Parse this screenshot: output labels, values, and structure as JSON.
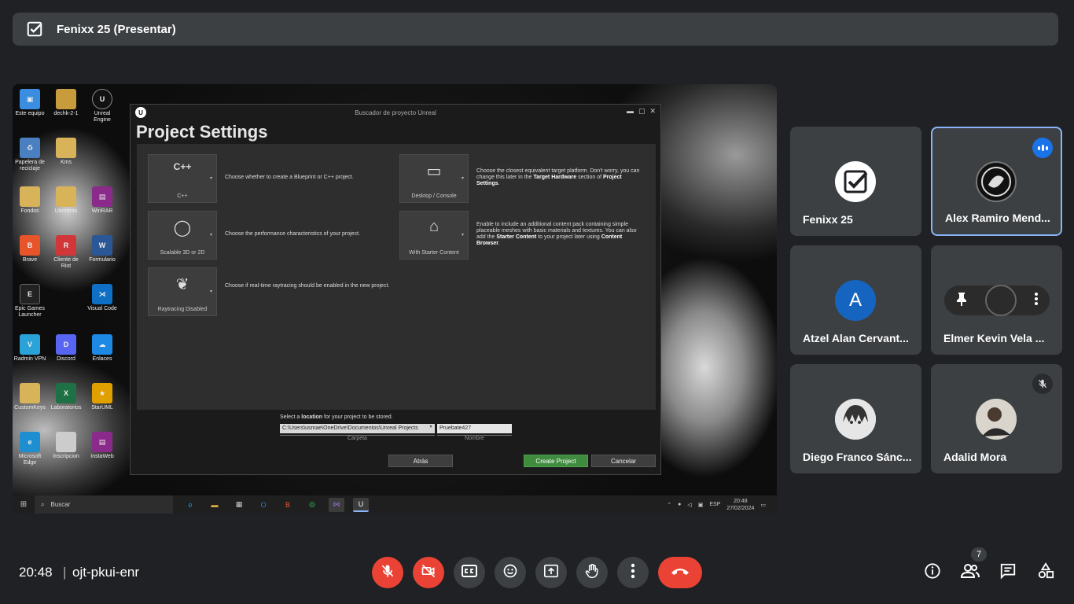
{
  "presenter": {
    "name": "Fenixx 25 (Presentar)"
  },
  "desktop": {
    "icons": [
      {
        "label": "Este equipo",
        "color": "#3a8de0"
      },
      {
        "label": "dechk-2-1",
        "color": "#c89b3c"
      },
      {
        "label": "Unreal Engine",
        "color": "#111111"
      },
      {
        "label": "Papelera de reciclaje",
        "color": "#4a7fc1"
      },
      {
        "label": "Kms",
        "color": "#d8b35a"
      },
      {
        "label": "Fondos",
        "color": "#d8b35a"
      },
      {
        "label": "Utorrents",
        "color": "#d8b35a"
      },
      {
        "label": "WinRAR",
        "color": "#8a2a8a"
      },
      {
        "label": "Brave",
        "color": "#e8542a"
      },
      {
        "label": "Cliente de Riot",
        "color": "#d13639"
      },
      {
        "label": "Formulario",
        "color": "#2b5797"
      },
      {
        "label": "Epic Games Launcher",
        "color": "#222222"
      },
      {
        "label": "Visual Code",
        "color": "#0e6fc5"
      },
      {
        "label": "Radmin VPN",
        "color": "#2aa3d8"
      },
      {
        "label": "Discord",
        "color": "#5865f2"
      },
      {
        "label": "Enlaces",
        "color": "#1e88e5"
      },
      {
        "label": "CustomKeys",
        "color": "#d8b35a"
      },
      {
        "label": "Laboratorios",
        "color": "#1e7145"
      },
      {
        "label": "StarUML",
        "color": "#e0a000"
      },
      {
        "label": "Microsoft Edge",
        "color": "#1d8fd1"
      },
      {
        "label": "Inscripcion",
        "color": "#cccccc"
      },
      {
        "label": "InstaWeb",
        "color": "#8a2a8a"
      }
    ]
  },
  "ue": {
    "window_title": "Buscador de proyecto Unreal",
    "heading": "Project Settings",
    "logo": "U",
    "options": [
      {
        "tile": "C++",
        "glyph": "C++",
        "desc": "Choose whether to create a Blueprint or C++ project."
      },
      {
        "tile": "Desktop / Console",
        "glyph": "▭",
        "desc_pre": "Choose the closest equivalent target platform. Don't worry, you can change this later in the ",
        "desc_b1": "Target Hardware",
        "desc_mid": " section of ",
        "desc_b2": "Project Settings",
        "desc_end": "."
      },
      {
        "tile": "Scalable 3D or 2D",
        "glyph": "◯",
        "desc": "Choose the performance characteristics of your project."
      },
      {
        "tile": "With Starter Content",
        "glyph": "⌂",
        "desc_pre": "Enable to include an additional content pack containing simple placeable meshes with basic materials and textures. You can also add the ",
        "desc_b1": "Starter Content",
        "desc_mid": " to your project later using ",
        "desc_b2": "Content Browser",
        "desc_end": "."
      },
      {
        "tile": "Raytracing Disabled",
        "glyph": "❦",
        "desc": "Choose if real-time raytracing should be enabled in the new project."
      }
    ],
    "location_pre": "Select a ",
    "location_bold": "location",
    "location_post": " for your project to be stored.",
    "path": "C:\\Users\\usmae\\OneDrive\\Documentos\\Unreal Projects",
    "project_name": "Pruebate427",
    "folder_label": "Carpeta",
    "name_label": "Nombre",
    "back_button": "Atrás",
    "create_button": "Create Project",
    "cancel_button": "Cancelar"
  },
  "taskbar": {
    "search_placeholder": "Buscar",
    "lang": "ESP",
    "time": "20:48",
    "date": "27/02/2024"
  },
  "participants": [
    {
      "name": "Fenixx 25"
    },
    {
      "name": "Alex Ramiro Mend..."
    },
    {
      "name": "Atzel Alan Cervant...",
      "initial": "A",
      "color": "#1565c0"
    },
    {
      "name": "Elmer Kevin Vela ..."
    },
    {
      "name": "Diego Franco Sánc..."
    },
    {
      "name": "Adalid Mora"
    }
  ],
  "bottom": {
    "time": "20:48",
    "separator": "|",
    "meeting_code": "ojt-pkui-enr",
    "participant_count": "7"
  },
  "colors": {
    "danger": "#ea4335",
    "accent": "#8ab4f8",
    "tile": "#3c4043"
  }
}
